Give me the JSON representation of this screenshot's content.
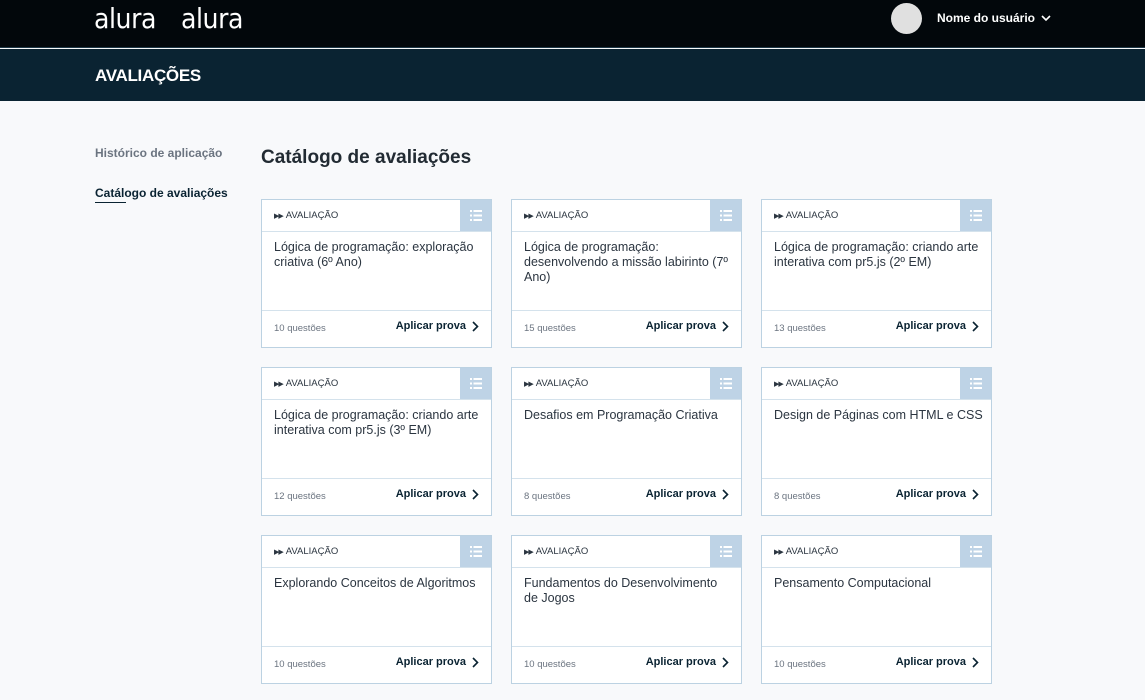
{
  "header": {
    "logos": [
      "alura",
      "alura"
    ],
    "user_name": "Nome do usuário"
  },
  "subheader": {
    "title": "AVALIAÇÕES"
  },
  "sidebar": {
    "items": [
      {
        "label": "Histórico de aplicação",
        "active": false
      },
      {
        "label": "Catálogo de avaliações",
        "active": true
      }
    ]
  },
  "main": {
    "title": "Catálogo de avaliações",
    "card_type_label": "AVALIAÇÃO",
    "apply_label": "Aplicar prova",
    "cards": [
      {
        "name": "Lógica de programação: exploração criativa (6º Ano)",
        "count": "10 questões"
      },
      {
        "name": "Lógica de programação: desenvolvendo a missão labirinto (7º Ano)",
        "count": "15 questões"
      },
      {
        "name": "Lógica de programação: criando arte interativa com pr5.js (2º EM)",
        "count": "13 questões"
      },
      {
        "name": "Lógica de programação: criando arte interativa com pr5.js (3º EM)",
        "count": "12 questões"
      },
      {
        "name": "Desafios em Programação Criativa",
        "count": "8 questões"
      },
      {
        "name": "Design de Páginas com HTML e CSS",
        "count": "8 questões"
      },
      {
        "name": "Explorando Conceitos de Algoritmos",
        "count": "10 questões"
      },
      {
        "name": "Fundamentos do Desenvolvimento de Jogos",
        "count": "10 questões"
      },
      {
        "name": "Pensamento Computacional",
        "count": "10 questões"
      }
    ]
  },
  "colors": {
    "topbar": "#02070b",
    "subbar": "#0a2332",
    "card_border": "#bcd2e2",
    "list_icon_bg": "#bed3e6",
    "accent_text": "#0a2332"
  },
  "icons": {
    "user_menu": "chevron-down-icon",
    "card_list": "list-icon",
    "card_type": "double-play-icon",
    "apply": "chevron-right-icon"
  }
}
